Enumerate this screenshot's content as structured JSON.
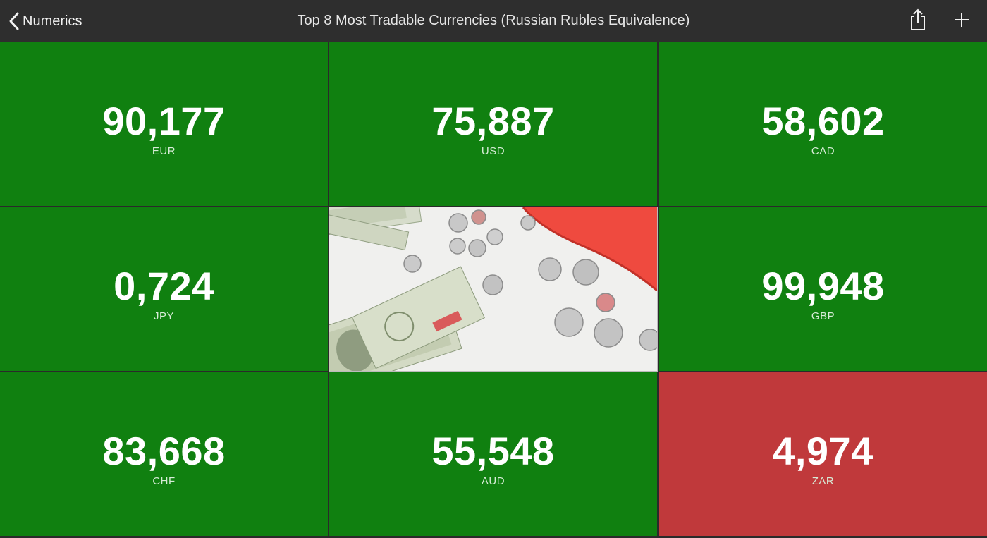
{
  "navbar": {
    "back_label": "Numerics",
    "title": "Top 8 Most Tradable Currencies (Russian Rubles Equivalence)",
    "back_icon": "chevron-left-icon",
    "share_icon": "share-icon",
    "add_icon": "plus-icon"
  },
  "colors": {
    "positive": "#108010",
    "negative": "#c0393b",
    "navbar": "#2e2e2e",
    "grid_gap": "#2a2a2a"
  },
  "tiles": [
    {
      "value": "90,177",
      "code": "EUR",
      "status": "positive"
    },
    {
      "value": "75,887",
      "code": "USD",
      "status": "positive"
    },
    {
      "value": "58,602",
      "code": "CAD",
      "status": "positive"
    },
    {
      "value": "0,724",
      "code": "JPY",
      "status": "positive"
    },
    {
      "value": "99,948",
      "code": "GBP",
      "status": "positive"
    },
    {
      "value": "83,668",
      "code": "CHF",
      "status": "positive"
    },
    {
      "value": "55,548",
      "code": "AUD",
      "status": "positive"
    },
    {
      "value": "4,974",
      "code": "ZAR",
      "status": "negative"
    }
  ],
  "photo": {
    "subject": "money-photo"
  }
}
